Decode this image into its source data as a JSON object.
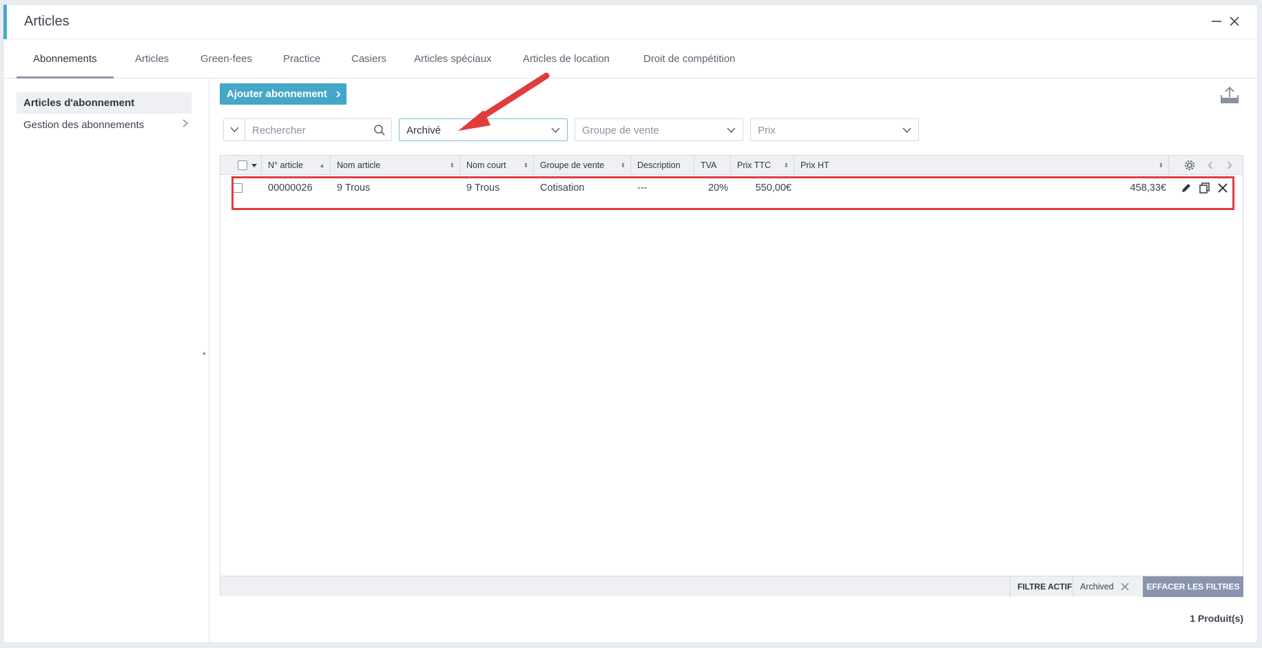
{
  "window": {
    "title": "Articles"
  },
  "tabs": [
    {
      "label": "Abonnements",
      "active": true
    },
    {
      "label": "Articles"
    },
    {
      "label": "Green-fees"
    },
    {
      "label": "Practice"
    },
    {
      "label": "Casiers"
    },
    {
      "label": "Articles spéciaux"
    },
    {
      "label": "Articles de location"
    },
    {
      "label": "Droit de compétition"
    }
  ],
  "sidebar": {
    "items": [
      {
        "label": "Articles d'abonnement",
        "active": true
      },
      {
        "label": "Gestion des abonnements"
      }
    ]
  },
  "toolbar": {
    "add_label": "Ajouter abonnement"
  },
  "filters": {
    "search_placeholder": "Rechercher",
    "status_value": "Archivé",
    "group_placeholder": "Groupe de vente",
    "price_placeholder": "Prix"
  },
  "table": {
    "columns": [
      "N° article",
      "Nom article",
      "Nom court",
      "Groupe de vente",
      "Description",
      "TVA",
      "Prix TTC",
      "Prix HT"
    ],
    "rows": [
      {
        "num": "00000026",
        "name": "9 Trous",
        "short": "9 Trous",
        "group": "Cotisation",
        "desc": "---",
        "tva": "20%",
        "ttc": "550,00€",
        "ht": "458,33€"
      }
    ]
  },
  "footer": {
    "filter_label": "FILTRE ACTIF",
    "active_filter": "Archived",
    "clear_label": "EFFACER LES FILTRES",
    "count": "1 Produit(s)"
  },
  "colors": {
    "accent": "#45a7c7",
    "highlight": "#e03c3c",
    "clear_button": "#8a94ad"
  }
}
